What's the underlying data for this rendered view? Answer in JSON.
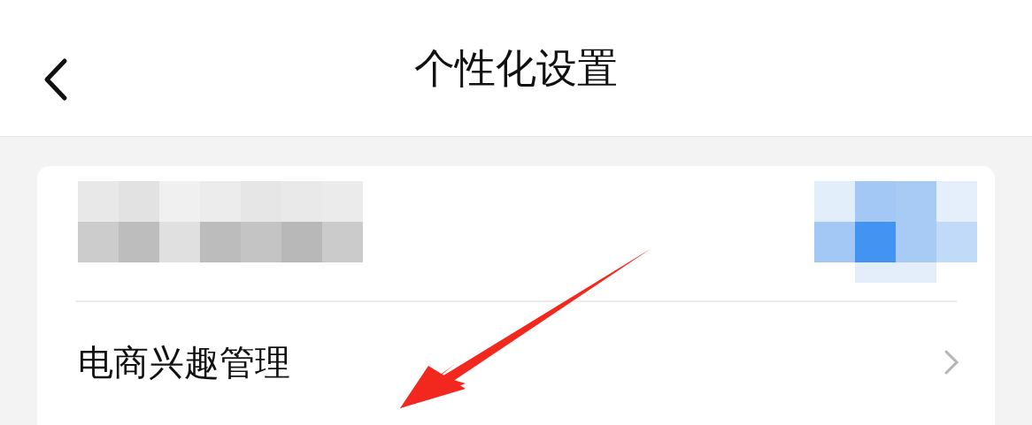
{
  "header": {
    "title": "个性化设置"
  },
  "settings": [
    {
      "label": "电商兴趣管理"
    }
  ]
}
